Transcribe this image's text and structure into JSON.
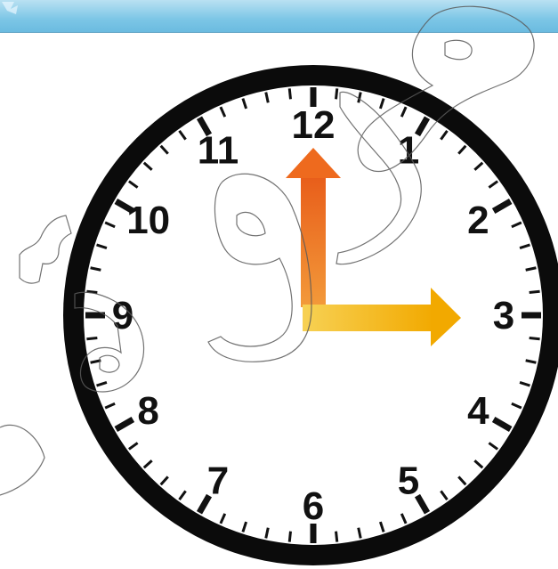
{
  "clock": {
    "numerals": [
      "12",
      "1",
      "2",
      "3",
      "4",
      "5",
      "6",
      "7",
      "8",
      "9",
      "10",
      "11"
    ],
    "time": {
      "hour": 3,
      "minute": 0
    },
    "colors": {
      "face": "#ffffff",
      "rim": "#0b0b0b",
      "ticks": "#111111",
      "minute_hand": "#ee6a1e",
      "hour_hand": "#f4b400",
      "watermark_stroke": "#555555",
      "top_bar": "#7cc6e6"
    }
  }
}
